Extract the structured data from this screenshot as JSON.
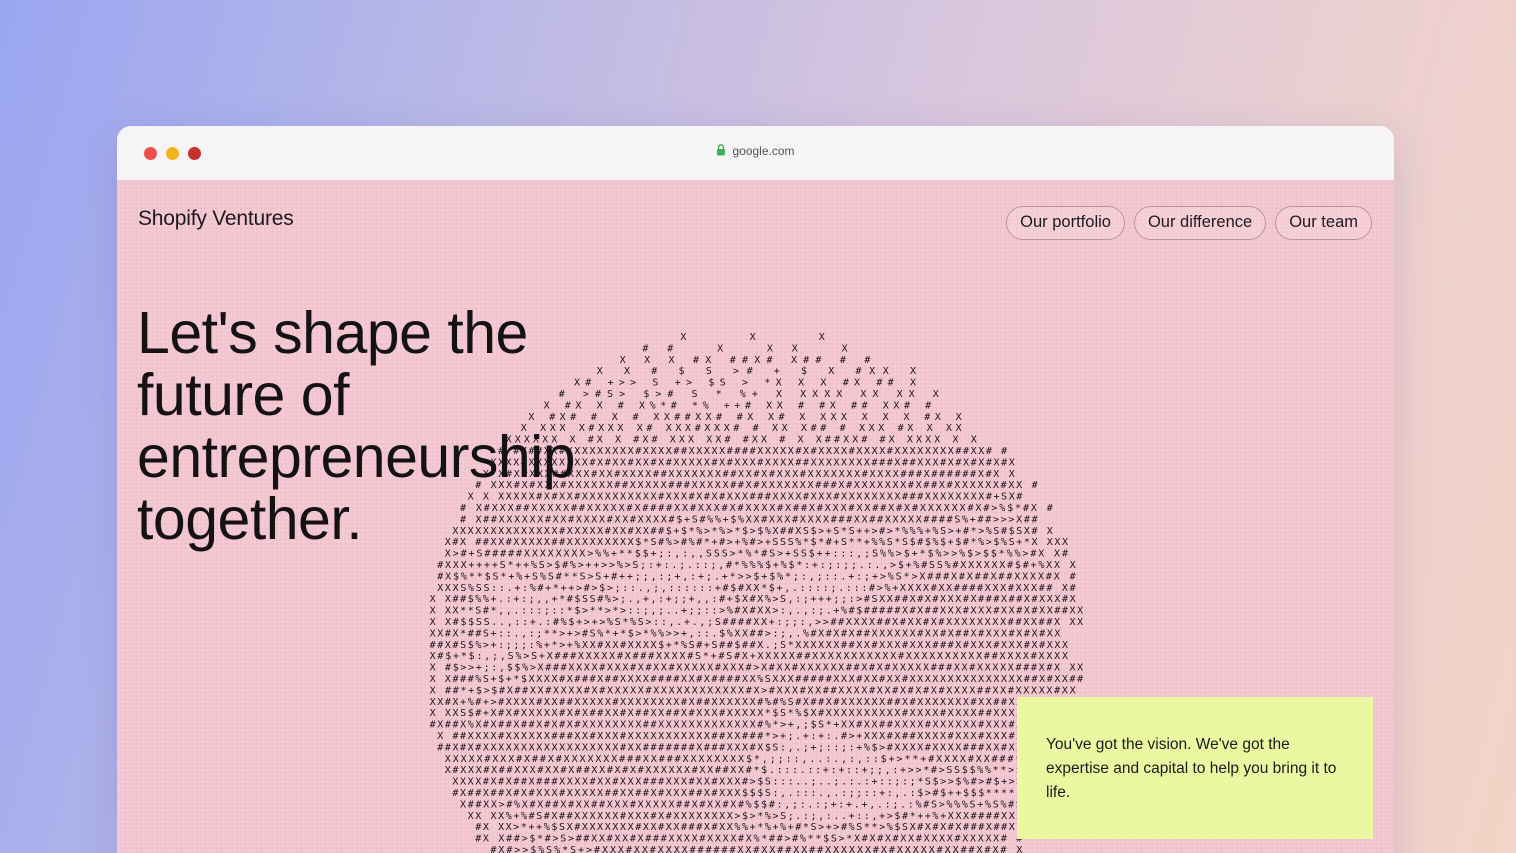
{
  "browser": {
    "url": "google.com",
    "lock_icon": "lock-icon",
    "traffic_lights": [
      "#ef4f4b",
      "#f2b41e",
      "#c8322c"
    ]
  },
  "header": {
    "brand": "Shopify Ventures",
    "nav": [
      {
        "label": "Our portfolio"
      },
      {
        "label": "Our difference"
      },
      {
        "label": "Our team"
      }
    ]
  },
  "hero": {
    "lines": [
      "Let's shape the",
      "future of",
      "entrepreneurship",
      "together."
    ]
  },
  "callout": {
    "text": "You've got the vision. We've got the expertise and capital to help you bring it to life."
  },
  "colors": {
    "page_bg": "#f3c5d1",
    "callout_bg": "#ecf7a2",
    "text": "#141213"
  }
}
